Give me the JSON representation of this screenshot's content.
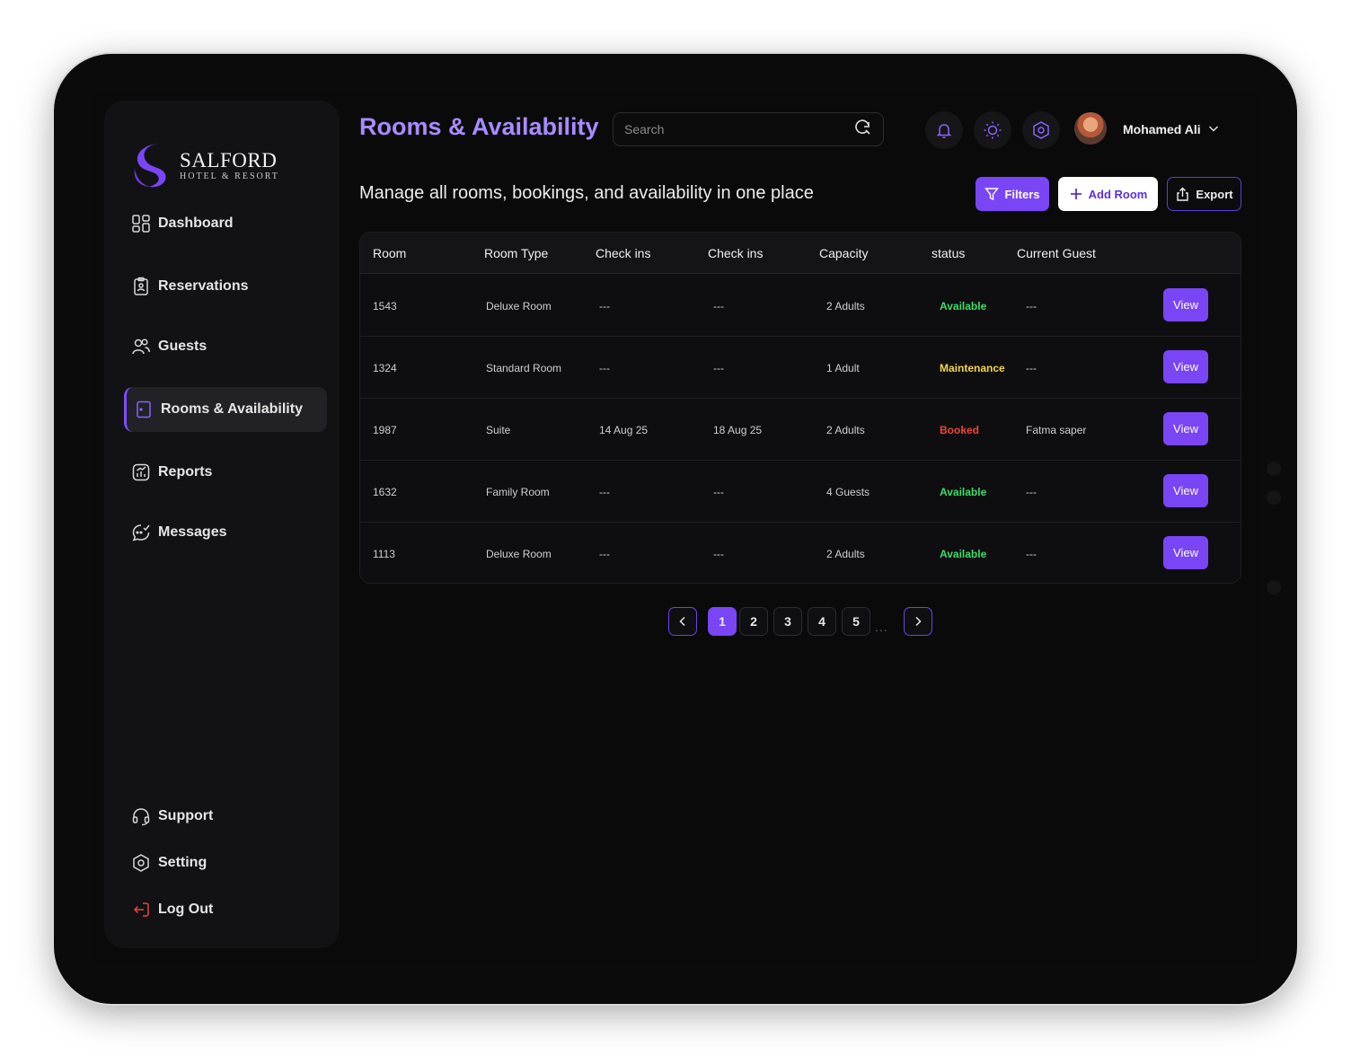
{
  "brand": {
    "name": "SALFORD",
    "tagline": "HOTEL & RESORT",
    "accent": "#7a45f5"
  },
  "sidebar": {
    "items": [
      {
        "label": "Dashboard",
        "icon": "dashboard-icon"
      },
      {
        "label": "Reservations",
        "icon": "clipboard-icon"
      },
      {
        "label": "Guests",
        "icon": "users-icon"
      },
      {
        "label": "Rooms & Availability",
        "icon": "door-icon",
        "active": true
      },
      {
        "label": "Reports",
        "icon": "chart-icon"
      },
      {
        "label": "Messages",
        "icon": "chat-icon"
      }
    ],
    "bottom": [
      {
        "label": "Support",
        "icon": "headset-icon"
      },
      {
        "label": "Setting",
        "icon": "hexagon-settings-icon"
      },
      {
        "label": "Log Out",
        "icon": "logout-icon"
      }
    ]
  },
  "header": {
    "title": "Rooms & Availability",
    "search_placeholder": "Search",
    "user_name": "Mohamed Ali"
  },
  "main": {
    "subtitle": "Manage all rooms, bookings, and availability in one place",
    "actions": {
      "filters": "Filters",
      "add_room": "Add Room",
      "export": "Export"
    },
    "table": {
      "headers": [
        "Room",
        "Room Type",
        "Check ins",
        "Check ins",
        "Capacity",
        "status",
        "Current Guest"
      ],
      "view_label": "View",
      "rows": [
        {
          "room": "1543",
          "type": "Deluxe Room",
          "checkin": "---",
          "checkout": "---",
          "capacity": "2 Adults",
          "status": "Available",
          "guest": "---"
        },
        {
          "room": "1324",
          "type": "Standard Room",
          "checkin": "---",
          "checkout": "---",
          "capacity": "1 Adult",
          "status": "Maintenance",
          "guest": "---"
        },
        {
          "room": "1987",
          "type": "Suite",
          "checkin": "14 Aug 25",
          "checkout": "18 Aug 25",
          "capacity": "2 Adults",
          "status": "Booked",
          "guest": "Fatma saper"
        },
        {
          "room": "1632",
          "type": "Family Room",
          "checkin": "---",
          "checkout": "---",
          "capacity": "4 Guests",
          "status": "Available",
          "guest": "---"
        },
        {
          "room": "1113",
          "type": "Deluxe Room",
          "checkin": "---",
          "checkout": "---",
          "capacity": "2 Adults",
          "status": "Available",
          "guest": "---"
        }
      ]
    },
    "status_colors": {
      "Available": "#3ddc6a",
      "Maintenance": "#f5d547",
      "Booked": "#f04438"
    },
    "pagination": {
      "pages": [
        "1",
        "2",
        "3",
        "4",
        "5"
      ],
      "current": "1",
      "ellipsis": "..."
    }
  }
}
